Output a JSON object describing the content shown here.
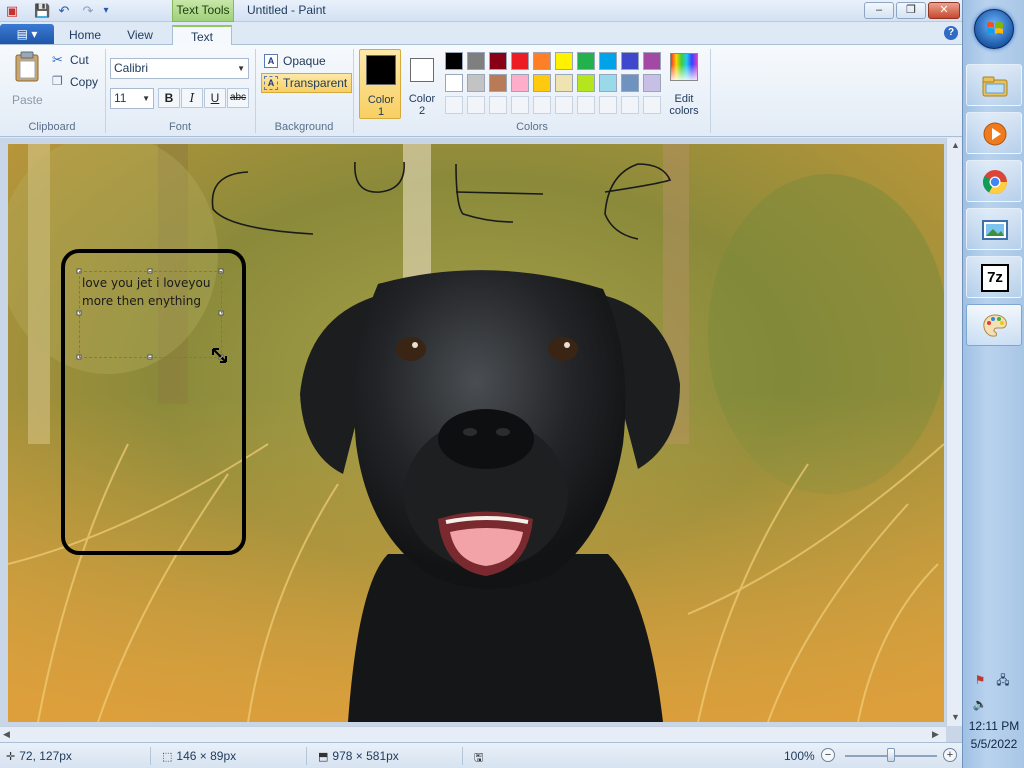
{
  "window": {
    "title": "Untitled - Paint",
    "contextual_tab_header": "Text Tools",
    "minimize": "–",
    "maximize": "❐",
    "close": "✕"
  },
  "qat": {
    "save_icon": "💾",
    "undo_icon": "↶",
    "redo_icon": "↷",
    "customize_icon": "▾"
  },
  "tabs": {
    "app_menu": "▤ ▾",
    "home": "Home",
    "view": "View",
    "text": "Text",
    "help": "?"
  },
  "clipboard": {
    "paste": "Paste",
    "cut": "Cut",
    "copy": "Copy",
    "group_label": "Clipboard"
  },
  "font": {
    "family": "Calibri",
    "size": "11",
    "bold": "B",
    "italic": "I",
    "underline": "U",
    "strikethrough": "abc",
    "group_label": "Font"
  },
  "background": {
    "opaque": "Opaque",
    "transparent": "Transparent",
    "group_label": "Background",
    "icon_letter": "A"
  },
  "colors": {
    "color1_label_1": "Color",
    "color1_label_2": "1",
    "color2_label_1": "Color",
    "color2_label_2": "2",
    "color1_value": "#000000",
    "color2_value": "#ffffff",
    "edit_label_1": "Edit",
    "edit_label_2": "colors",
    "group_label": "Colors",
    "palette_row1": [
      "#000000",
      "#7f7f7f",
      "#880015",
      "#ed1c24",
      "#ff7f27",
      "#fff200",
      "#22b14c",
      "#00a2e8",
      "#3f48cc",
      "#a349a4"
    ],
    "palette_row2": [
      "#ffffff",
      "#c3c3c3",
      "#b97a57",
      "#ffaec9",
      "#ffc90e",
      "#efe4b0",
      "#b5e61d",
      "#99d9ea",
      "#7092be",
      "#c8bfe7"
    ],
    "palette_row3_count": 10
  },
  "canvas": {
    "text_line1": "love you jet i loveyou",
    "text_line2": "more then enything"
  },
  "status": {
    "cursor_pos": "72, 127px",
    "selection_size": "146 × 89px",
    "image_size": "978 × 581px",
    "zoom": "100%",
    "zoom_level_fraction": 0.5
  },
  "taskbar": {
    "apps": [
      "explorer-icon",
      "media-player-icon",
      "chrome-icon",
      "photo-viewer-icon",
      "7zip-icon",
      "paint-icon"
    ],
    "sevenzip_label": "7z",
    "clock_time": "12:11 PM",
    "clock_date": "5/5/2022"
  }
}
